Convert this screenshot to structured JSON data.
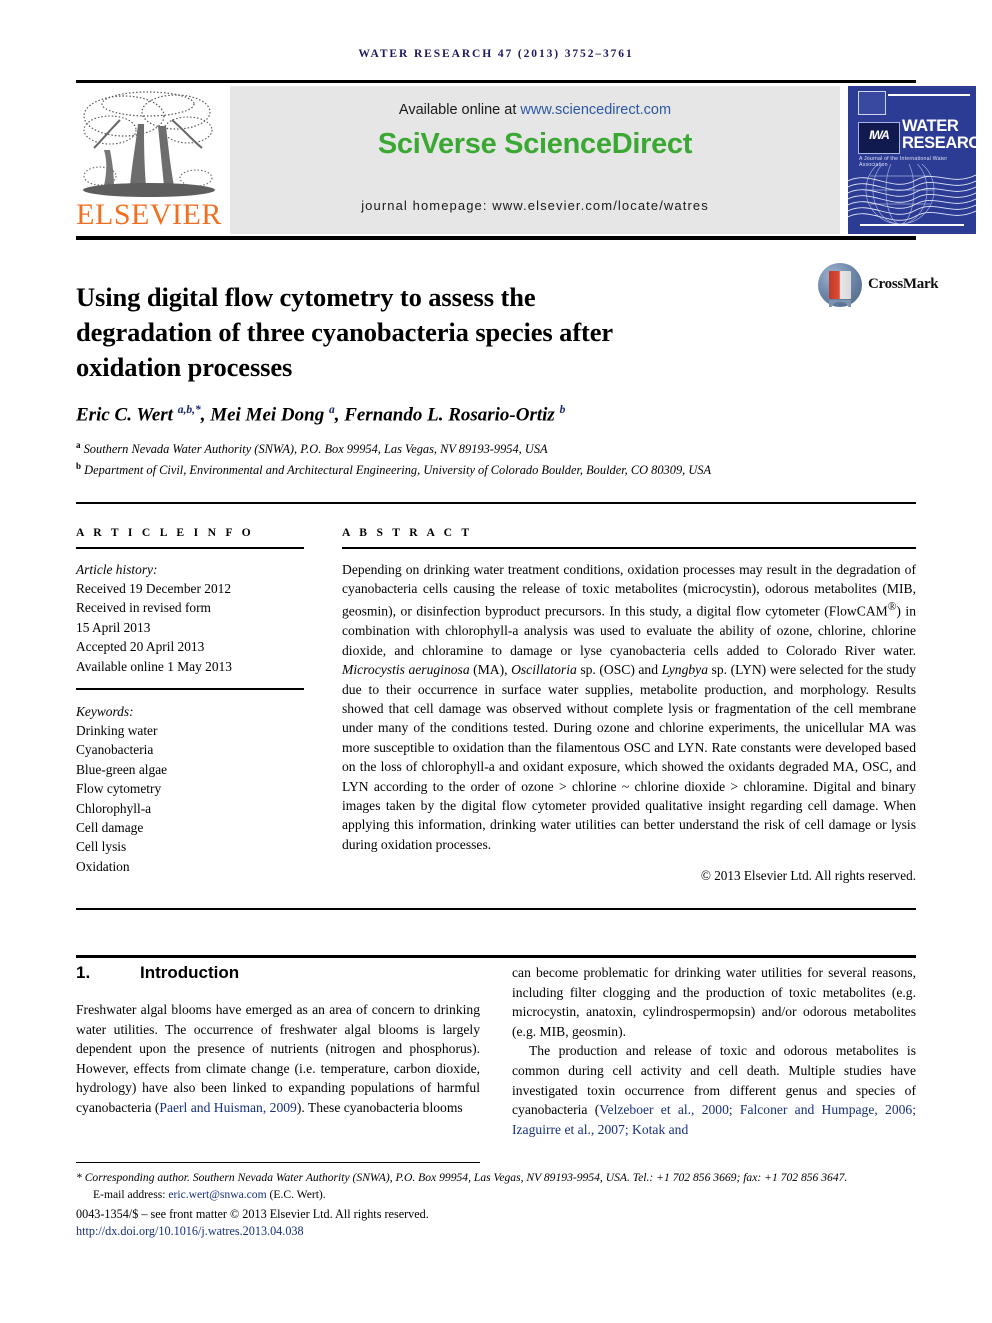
{
  "running_head": "WATER RESEARCH 47 (2013) 3752–3761",
  "masthead": {
    "elsevier_wordmark": "ELSEVIER",
    "available_prefix": "Available online at ",
    "available_url": "www.sciencedirect.com",
    "sciverse_title": "SciVerse ScienceDirect",
    "journal_homepage": "journal homepage: www.elsevier.com/locate/watres",
    "cover": {
      "title_line1": "WATER",
      "title_line2": "RESEARCH",
      "subtitle": "A Journal of the International Water Association",
      "iwa_mark": "IWA"
    }
  },
  "article": {
    "title": "Using digital flow cytometry to assess the degradation of three cyanobacteria species after oxidation processes",
    "crossmark_label": "CrossMark",
    "authors_html": "Eric C. Wert <sup>a,b,*</sup>, Mei Mei Dong <sup>a</sup>, Fernando L. Rosario-Ortiz <sup>b</sup>",
    "affiliation_a": "Southern Nevada Water Authority (SNWA), P.O. Box 99954, Las Vegas, NV 89193-9954, USA",
    "affiliation_b": "Department of Civil, Environmental and Architectural Engineering, University of Colorado Boulder, Boulder, CO 80309, USA"
  },
  "info": {
    "heading": "A R T I C L E   I N F O",
    "history_label": "Article history:",
    "history": [
      "Received 19 December 2012",
      "Received in revised form",
      "15 April 2013",
      "Accepted 20 April 2013",
      "Available online 1 May 2013"
    ],
    "keywords_label": "Keywords:",
    "keywords": [
      "Drinking water",
      "Cyanobacteria",
      "Blue-green algae",
      "Flow cytometry",
      "Chlorophyll-a",
      "Cell damage",
      "Cell lysis",
      "Oxidation"
    ]
  },
  "abstract": {
    "heading": "A B S T R A C T",
    "text_html": "Depending on drinking water treatment conditions, oxidation processes may result in the degradation of cyanobacteria cells causing the release of toxic metabolites (microcystin), odorous metabolites (MIB, geosmin), or disinfection byproduct precursors. In this study, a digital flow cytometer (FlowCAM<sup>®</sup>) in combination with chlorophyll-a analysis was used to evaluate the ability of ozone, chlorine, chlorine dioxide, and chloramine to damage or lyse cyanobacteria cells added to Colorado River water. <i>Microcystis aeruginosa</i> (MA), <i>Oscillatoria</i> sp. (OSC) and <i>Lyngbya</i> sp. (LYN) were selected for the study due to their occurrence in surface water supplies, metabolite production, and morphology. Results showed that cell damage was observed without complete lysis or fragmentation of the cell membrane under many of the conditions tested. During ozone and chlorine experiments, the unicellular MA was more susceptible to oxidation than the filamentous OSC and LYN. Rate constants were developed based on the loss of chlorophyll-a and oxidant exposure, which showed the oxidants degraded MA, OSC, and LYN according to the order of ozone &gt; chlorine ~ chlorine dioxide &gt; chloramine. Digital and binary images taken by the digital flow cytometer provided qualitative insight regarding cell damage. When applying this information, drinking water utilities can better understand the risk of cell damage or lysis during oxidation processes.",
    "copyright": "© 2013 Elsevier Ltd. All rights reserved."
  },
  "body": {
    "section_number": "1.",
    "section_title": "Introduction",
    "left_paragraph_html": "Freshwater algal blooms have emerged as an area of concern to drinking water utilities. The occurrence of freshwater algal blooms is largely dependent upon the presence of nutrients (nitrogen and phosphorus). However, effects from climate change (i.e. temperature, carbon dioxide, hydrology) have also been linked to expanding populations of harmful cyanobacteria (<span class=\"cite\">Paerl and Huisman, 2009</span>). These cyanobacteria blooms",
    "right_paragraph1_html": "can become problematic for drinking water utilities for several reasons, including filter clogging and the production of toxic metabolites (e.g. microcystin, anatoxin, cylindrospermopsin) and/or odorous metabolites (e.g. MIB, geosmin).",
    "right_paragraph2_html": "The production and release of toxic and odorous metabolites is common during cell activity and cell death. Multiple studies have investigated toxin occurrence from different genus and species of cyanobacteria (<span class=\"cite\">Velzeboer et al., 2000; Falconer and Humpage, 2006; Izaguirre et al., 2007; Kotak and</span>"
  },
  "footnotes": {
    "corresponding_html": "<span class=\"corr\">* <i>Corresponding author.</i> Southern Nevada Water Authority (SNWA), P.O. Box 99954, Las Vegas, NV 89193-9954, USA. Tel.: +1 702 856 3669; fax: +1 702 856 3647.</span>",
    "email_label": "E-mail address:",
    "email": "eric.wert@snwa.com",
    "email_suffix": "(E.C. Wert).",
    "front_matter": "0043-1354/$ – see front matter © 2013 Elsevier Ltd. All rights reserved.",
    "doi": "http://dx.doi.org/10.1016/j.watres.2013.04.038"
  },
  "colors": {
    "elsevier_orange": "#f26f21",
    "sciencedirect_green": "#3aa832",
    "link_blue": "#17307e",
    "cover_blue": "#2c3b93",
    "runhead_navy": "#1a1a5e"
  }
}
